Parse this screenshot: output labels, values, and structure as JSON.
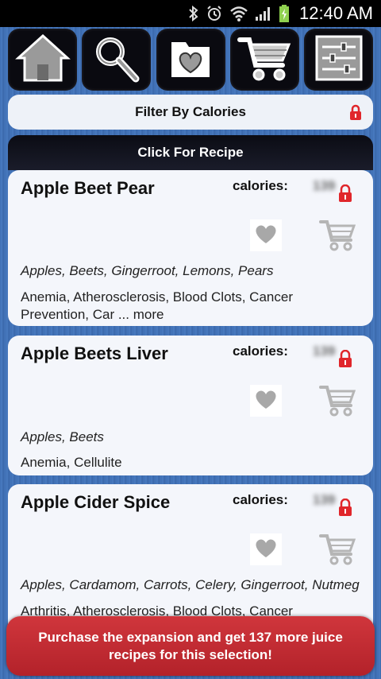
{
  "status_bar": {
    "time": "12:40 AM"
  },
  "toolbar": {
    "buttons": [
      {
        "icon": "home-icon"
      },
      {
        "icon": "search-icon"
      },
      {
        "icon": "favorites-folder-icon"
      },
      {
        "icon": "cart-icon"
      },
      {
        "icon": "settings-sliders-icon"
      }
    ]
  },
  "filter": {
    "label": "Filter By Calories"
  },
  "recipe_header": {
    "label": "Click For Recipe"
  },
  "recipes": [
    {
      "title": "Apple Beet Pear",
      "calories_label": "calories:",
      "calories_value": "139",
      "ingredients": "Apples, Beets, Gingerroot, Lemons, Pears",
      "benefits": "Anemia, Atherosclerosis, Blood Clots, Cancer Prevention, Car ... more"
    },
    {
      "title": "Apple Beets Liver",
      "calories_label": "calories:",
      "calories_value": "139",
      "ingredients": "Apples, Beets",
      "benefits": "Anemia, Cellulite"
    },
    {
      "title": "Apple Cider Spice",
      "calories_label": "calories:",
      "calories_value": "139",
      "ingredients": "Apples, Cardamom, Carrots, Celery, Gingerroot, Nutmeg",
      "benefits": "Arthritis, Atherosclerosis, Blood Clots, Cancer"
    }
  ],
  "purchase": {
    "text": "Purchase the expansion and get 137 more juice recipes for this selection!"
  },
  "colors": {
    "accent_red": "#c62b33",
    "lock_red": "#e0262b",
    "toolbar_bg": "#0a0a10"
  }
}
